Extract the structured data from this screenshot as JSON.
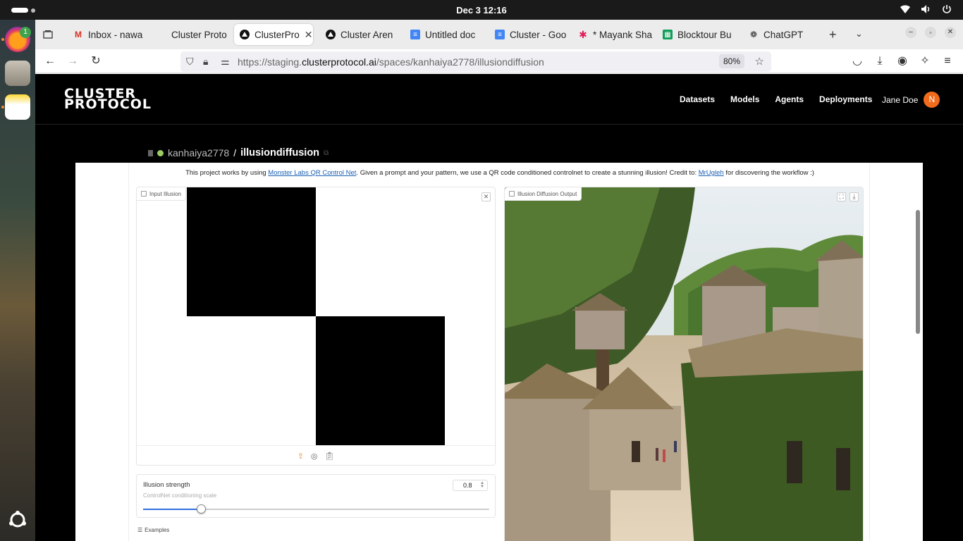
{
  "system": {
    "clock": "Dec 3  12:16",
    "dock_badge": "1"
  },
  "browser": {
    "tabs": [
      {
        "label": "Inbox - nawa",
        "icon": "gmail-icon"
      },
      {
        "label": "Cluster Proto",
        "icon": "cluster-icon"
      },
      {
        "label": "ClusterPro",
        "icon": "cluster-protocol-icon",
        "active": true
      },
      {
        "label": "Cluster Aren",
        "icon": "cluster-protocol-icon"
      },
      {
        "label": "Untitled doc",
        "icon": "google-docs-icon"
      },
      {
        "label": "Cluster - Goo",
        "icon": "google-docs-icon"
      },
      {
        "label": "* Mayank Sha",
        "icon": "slack-icon"
      },
      {
        "label": "Blocktour Bu",
        "icon": "google-sheets-icon"
      },
      {
        "label": "ChatGPT",
        "icon": "chatgpt-icon"
      }
    ],
    "url_prefix": "https://staging.",
    "url_domain": "clusterprotocol.ai",
    "url_path": "/spaces/kanhaiya2778/illusiondiffusion",
    "zoom": "80%"
  },
  "site": {
    "logo_line1": "CLUSTER",
    "logo_line2": "PROTOCOL",
    "nav": [
      "Datasets",
      "Models",
      "Agents",
      "Deployments"
    ],
    "user_name": "Jane Doe",
    "user_initial": "N"
  },
  "space": {
    "owner": "kanhaiya2778",
    "separator": "/",
    "repo": "illusiondiffusion",
    "desc_pre": "This project works by using ",
    "desc_link1": "Monster Labs QR Control Net",
    "desc_mid": ". Given a prompt and your pattern, we use a QR code conditioned controlnet to create a stunning illusion! Credit to: ",
    "desc_link2": "MrUgleh",
    "desc_post": " for discovering the workflow :)",
    "input_label": "Input Illusion",
    "output_label": "Illusion Diffusion Output",
    "slider_label": "Illusion strength",
    "slider_info": "ControlNet conditioning scale",
    "slider_value": "0.8",
    "slider_fraction": 0.166,
    "examples_label": "Examples"
  },
  "colors": {
    "accent": "#2f6fde",
    "avatar": "#f26b1d",
    "upload_icon": "#f28b30"
  }
}
